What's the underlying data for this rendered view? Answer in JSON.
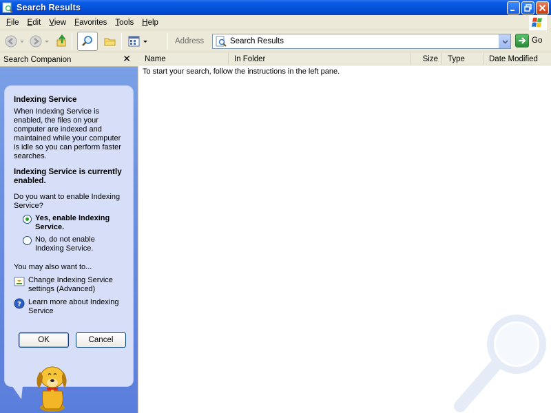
{
  "window": {
    "title": "Search Results"
  },
  "menubar": {
    "items": [
      {
        "label": "File",
        "underline": "F",
        "rest": "ile"
      },
      {
        "label": "Edit",
        "underline": "E",
        "rest": "dit"
      },
      {
        "label": "View",
        "underline": "V",
        "rest": "iew"
      },
      {
        "label": "Favorites",
        "underline": "F",
        "rest": "avorites",
        "ul_index": 0
      },
      {
        "label": "Tools",
        "underline": "T",
        "rest": "ools"
      },
      {
        "label": "Help",
        "underline": "H",
        "rest": "elp"
      }
    ]
  },
  "toolbar": {
    "address_label": "Address",
    "address_value": "Search Results",
    "go_label": "Go",
    "icons": [
      "back-icon",
      "forward-icon",
      "up-folder-icon",
      "search-icon",
      "folders-icon",
      "views-icon"
    ]
  },
  "companion": {
    "header_title": "Search Companion",
    "close_glyph": "✕",
    "title": "Indexing Service",
    "description": "When Indexing Service is enabled, the files on your computer are indexed and maintained while your computer is idle so you can perform faster searches.",
    "status": "Indexing Service is currently enabled.",
    "question": "Do you want to enable Indexing Service?",
    "options": [
      {
        "label": "Yes, enable Indexing Service.",
        "selected": true
      },
      {
        "label": "No, do not enable Indexing Service.",
        "selected": false
      }
    ],
    "also_want": "You may also want to...",
    "links": [
      {
        "label": "Change Indexing Service settings (Advanced)",
        "icon": "settings-icon"
      },
      {
        "label": "Learn more about Indexing Service",
        "icon": "help-icon"
      }
    ],
    "ok_label": "OK",
    "cancel_label": "Cancel"
  },
  "results": {
    "columns": [
      "Name",
      "In Folder",
      "Size",
      "Type",
      "Date Modified"
    ],
    "instructions": "To start your search, follow the instructions in the left pane."
  }
}
